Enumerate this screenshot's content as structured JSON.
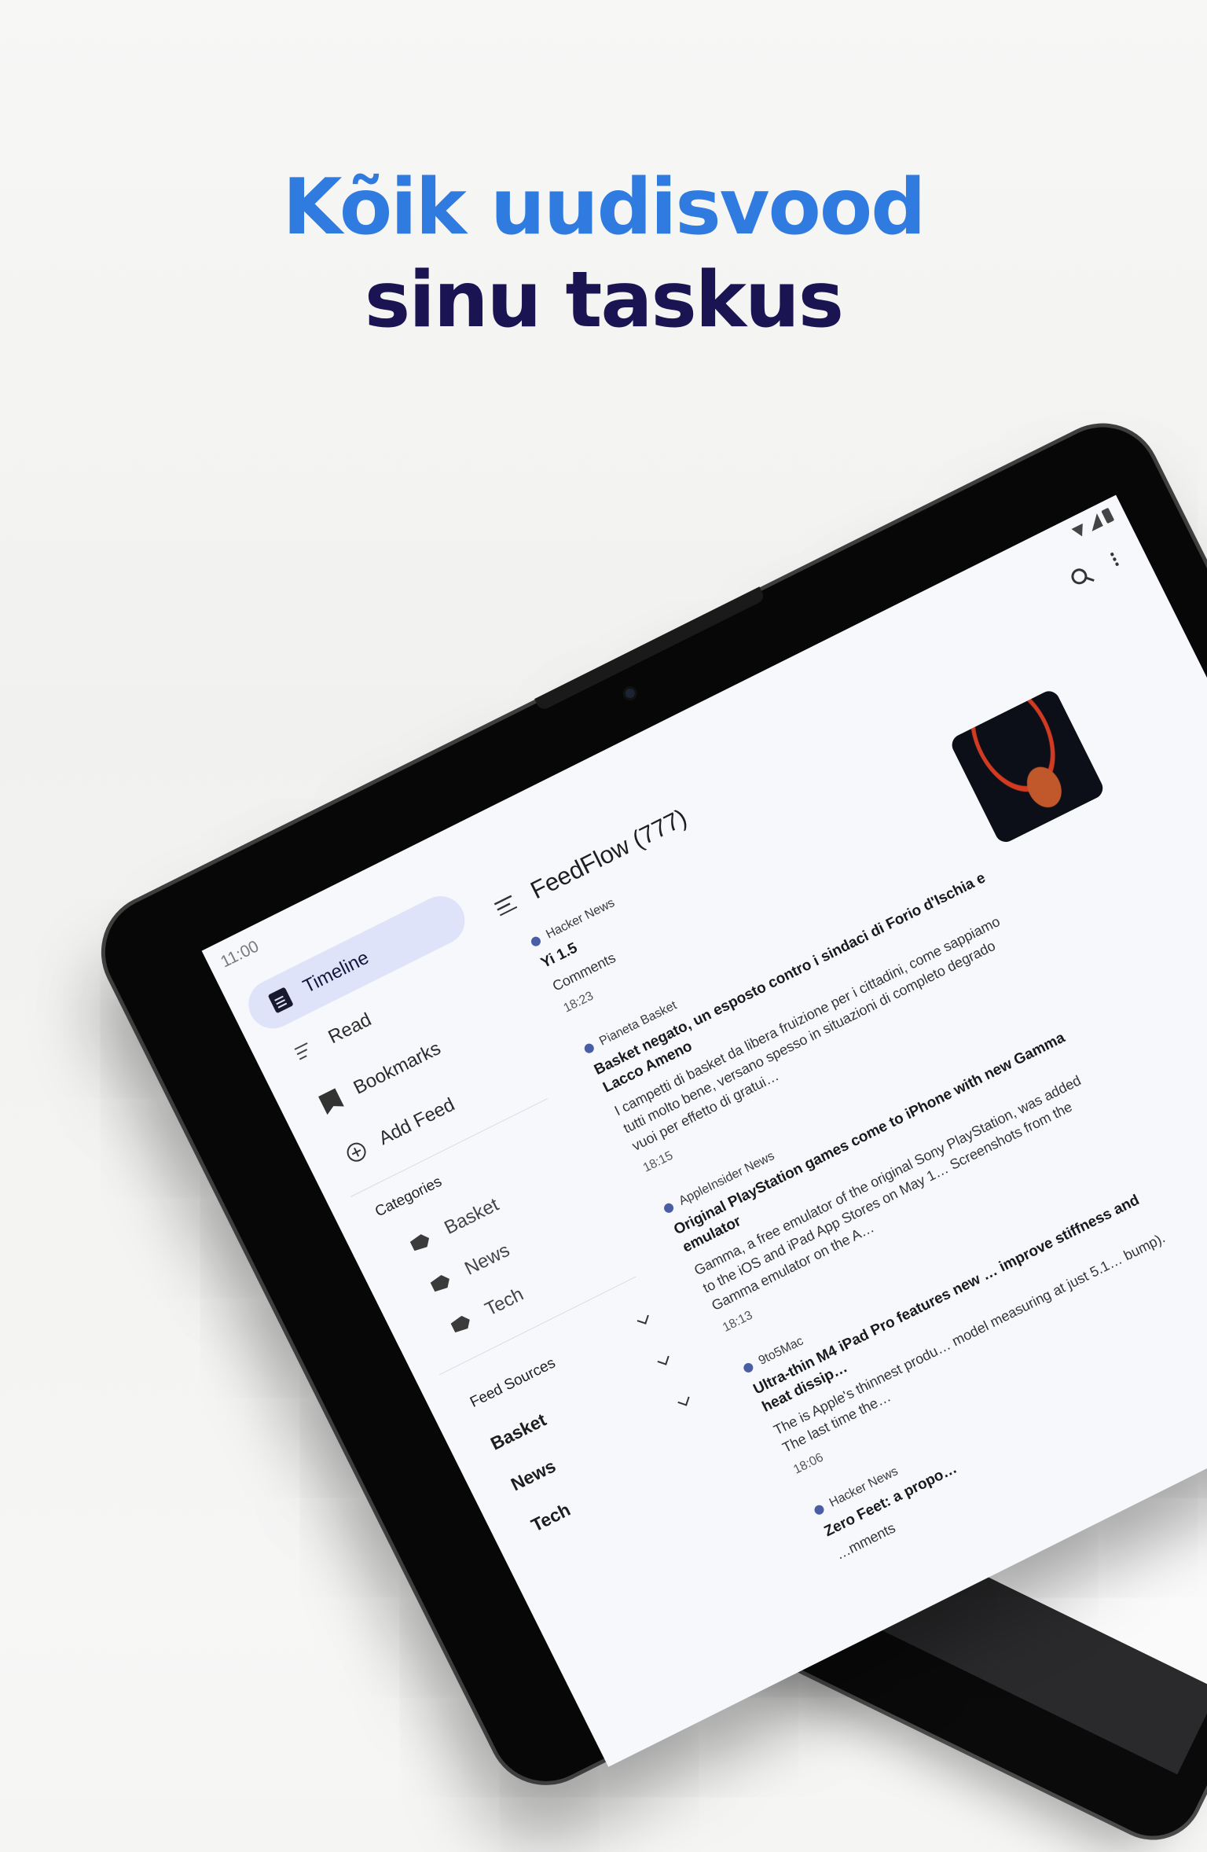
{
  "hero": {
    "line1": "Kõik uudisvood",
    "line2": "sinu taskus"
  },
  "status": {
    "time": "11:00"
  },
  "app": {
    "title": "FeedFlow (777)"
  },
  "drawer": {
    "nav": [
      {
        "label": "Timeline",
        "icon": "doc-icon",
        "active": true
      },
      {
        "label": "Read",
        "icon": "check-list-icon"
      },
      {
        "label": "Bookmarks",
        "icon": "bookmark-icon"
      },
      {
        "label": "Add Feed",
        "icon": "plus-circle-icon"
      }
    ],
    "categories_title": "Categories",
    "categories": [
      "Basket",
      "News",
      "Tech"
    ],
    "sources_title": "Feed Sources",
    "sources": [
      "Basket",
      "News",
      "Tech"
    ]
  },
  "feed": [
    {
      "source": "Hacker News",
      "title": "Yi 1.5",
      "body": "Comments",
      "time": "18:23"
    },
    {
      "source": "Pianeta Basket",
      "title": "Basket negato, un esposto contro i sindaci di Forio d'Ischia e Lacco Ameno",
      "body": "I campetti di basket da libera fruizione per i cittadini, come sappiamo tutti molto bene, versano spesso in situazioni di completo degrado vuoi per effetto di gratui…",
      "time": "18:15"
    },
    {
      "source": "AppleInsider News",
      "title": "Original PlayStation games come to iPhone with new Gamma emulator",
      "body": "Gamma, a free emulator of the original Sony PlayStation, was added to the iOS and iPad App Stores on May 1… Screenshots from the Gamma emulator on the A…",
      "time": "18:13"
    },
    {
      "source": "9to5Mac",
      "title": "Ultra-thin M4 iPad Pro features new … improve stiffness and heat dissip…",
      "body": "The is Apple's thinnest produ… model measuring at just 5.1… bump). The last time the…",
      "time": "18:06"
    },
    {
      "source": "Hacker News",
      "title": "Zero Feet: a propo…",
      "body": "…mments",
      "time": ""
    }
  ]
}
